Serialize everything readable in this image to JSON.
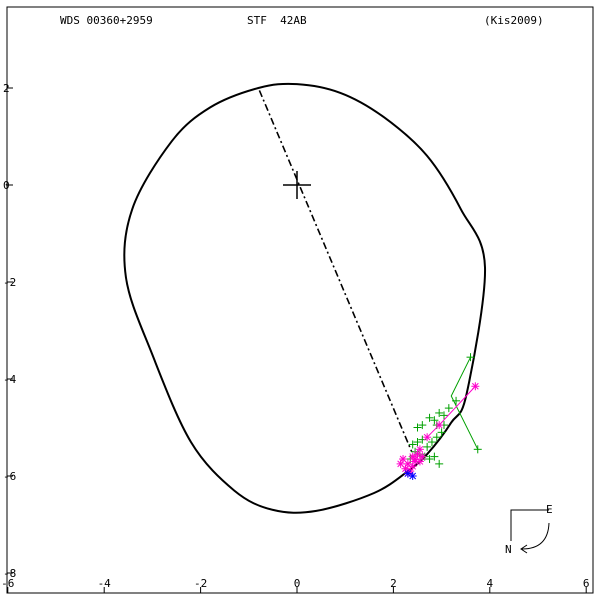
{
  "header": {
    "left": "WDS 00360+2959",
    "center": "STF  42AB",
    "right": "(Kis2009)"
  },
  "chart_data": {
    "type": "scatter",
    "title": "",
    "xlabel": "",
    "ylabel": "",
    "xlim": [
      -6,
      6
    ],
    "ylim": [
      -8,
      3
    ],
    "x_ticks": [
      -6,
      -4,
      -2,
      0,
      2,
      4,
      6
    ],
    "y_ticks": [
      2,
      0,
      -2,
      -4,
      -6,
      -8
    ],
    "orbit": {
      "points": [
        [
          -0.8,
          2.0
        ],
        [
          0.0,
          2.08
        ],
        [
          0.9,
          1.9
        ],
        [
          1.8,
          1.4
        ],
        [
          2.7,
          0.6
        ],
        [
          3.4,
          -0.5
        ],
        [
          3.9,
          -1.7
        ],
        [
          3.52,
          -4.3
        ],
        [
          3.2,
          -4.9
        ],
        [
          2.7,
          -5.55
        ],
        [
          2.3,
          -5.9
        ],
        [
          1.6,
          -6.35
        ],
        [
          0.4,
          -6.72
        ],
        [
          -0.5,
          -6.7
        ],
        [
          -1.3,
          -6.3
        ],
        [
          -2.2,
          -5.3
        ],
        [
          -3.0,
          -3.5
        ],
        [
          -3.55,
          -1.9
        ],
        [
          -3.42,
          -0.5
        ],
        [
          -2.6,
          0.9
        ],
        [
          -1.8,
          1.6
        ]
      ],
      "color": "#000000"
    },
    "node_line": {
      "from": [
        -0.78,
        1.95
      ],
      "to": [
        2.38,
        -5.5
      ]
    },
    "primary": [
      0.0,
      0.0
    ],
    "green_series": {
      "color": "#00a000",
      "marker": "plus",
      "points": [
        [
          3.6,
          -3.55
        ],
        [
          3.75,
          -5.45
        ],
        [
          3.3,
          -4.45
        ],
        [
          3.15,
          -4.6
        ],
        [
          3.05,
          -4.75
        ],
        [
          2.95,
          -4.7
        ],
        [
          2.85,
          -4.85
        ],
        [
          2.75,
          -4.8
        ],
        [
          2.6,
          -4.95
        ],
        [
          2.5,
          -5.0
        ],
        [
          3.0,
          -5.1
        ],
        [
          2.9,
          -5.2
        ],
        [
          2.8,
          -5.3
        ],
        [
          2.7,
          -5.4
        ],
        [
          2.6,
          -5.25
        ],
        [
          2.5,
          -5.3
        ],
        [
          2.85,
          -5.6
        ],
        [
          2.95,
          -5.75
        ],
        [
          2.4,
          -5.35
        ],
        [
          2.45,
          -5.5
        ],
        [
          2.55,
          -5.55
        ],
        [
          2.65,
          -5.6
        ],
        [
          2.35,
          -5.65
        ],
        [
          2.75,
          -5.65
        ],
        [
          3.05,
          -4.95
        ],
        [
          2.9,
          -4.95
        ]
      ]
    },
    "magenta_series": {
      "color": "#ff00cc",
      "marker": "star",
      "points": [
        [
          3.7,
          -4.15
        ],
        [
          2.95,
          -4.95
        ],
        [
          2.7,
          -5.2
        ],
        [
          2.55,
          -5.45
        ],
        [
          2.6,
          -5.6
        ],
        [
          2.5,
          -5.55
        ],
        [
          2.45,
          -5.7
        ],
        [
          2.4,
          -5.8
        ],
        [
          2.3,
          -5.75
        ],
        [
          2.2,
          -5.65
        ],
        [
          2.25,
          -5.85
        ],
        [
          2.35,
          -5.9
        ],
        [
          2.15,
          -5.75
        ],
        [
          2.45,
          -5.65
        ],
        [
          2.3,
          -5.95
        ],
        [
          2.55,
          -5.7
        ],
        [
          2.4,
          -5.6
        ]
      ]
    },
    "blue_series": {
      "color": "#0000ff",
      "marker": "star",
      "points": [
        [
          2.4,
          -6.0
        ],
        [
          2.3,
          -5.95
        ]
      ]
    },
    "compass": {
      "east": "E",
      "north": "N"
    }
  }
}
